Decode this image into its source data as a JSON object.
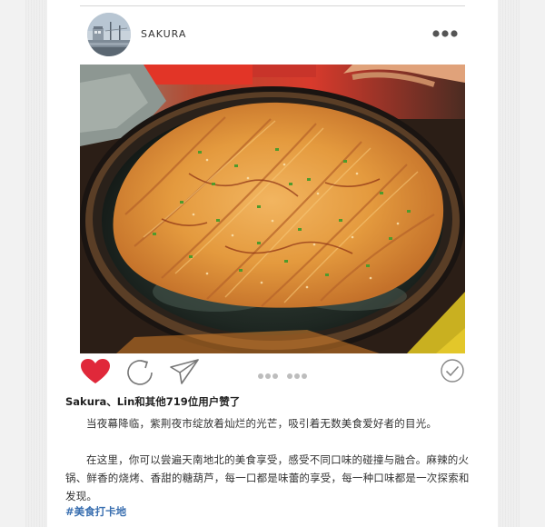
{
  "post": {
    "username": "SAKURA",
    "likes_text": "Sakura、Lin和其他719位用户赞了",
    "paragraphs": [
      "当夜幕降临，紫荆夜市绽放着灿烂的光芒，吸引着无数美食爱好者的目光。",
      "在这里，你可以尝遍天南地北的美食享受，感受不同口味的碰撞与融合。麻辣的火锅、鲜香的烧烤、香甜的糖葫芦，每一口都是味蕾的享受，每一种口味都是一次探索和发现。"
    ],
    "hashtag": "#美食打卡地"
  },
  "icons": {
    "avatar": "avatar-photo",
    "more": "more-dots-icon",
    "like": "heart-icon",
    "share": "refresh-share-icon",
    "send": "paper-plane-icon",
    "pager": "carousel-dots-icon",
    "save": "check-circle-icon"
  },
  "colors": {
    "like_red": "#e0283a",
    "hashtag_blue": "#3a6fb0",
    "icon_gray": "#777777"
  }
}
